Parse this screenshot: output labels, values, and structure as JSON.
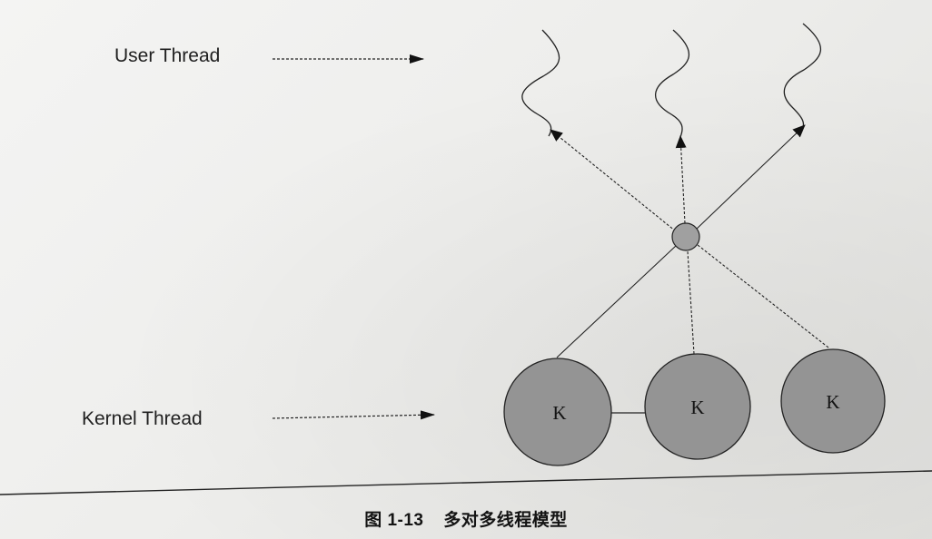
{
  "labels": {
    "user_thread": "User Thread",
    "kernel_thread": "Kernel Thread"
  },
  "kernel_nodes": [
    {
      "label": "K"
    },
    {
      "label": "K"
    },
    {
      "label": "K"
    }
  ],
  "caption": {
    "figure_number": "图 1-13",
    "title": "多对多线程模型"
  },
  "colors": {
    "kernel_fill": "#949494",
    "mux_fill": "#a0a0a0",
    "line": "#222222"
  }
}
